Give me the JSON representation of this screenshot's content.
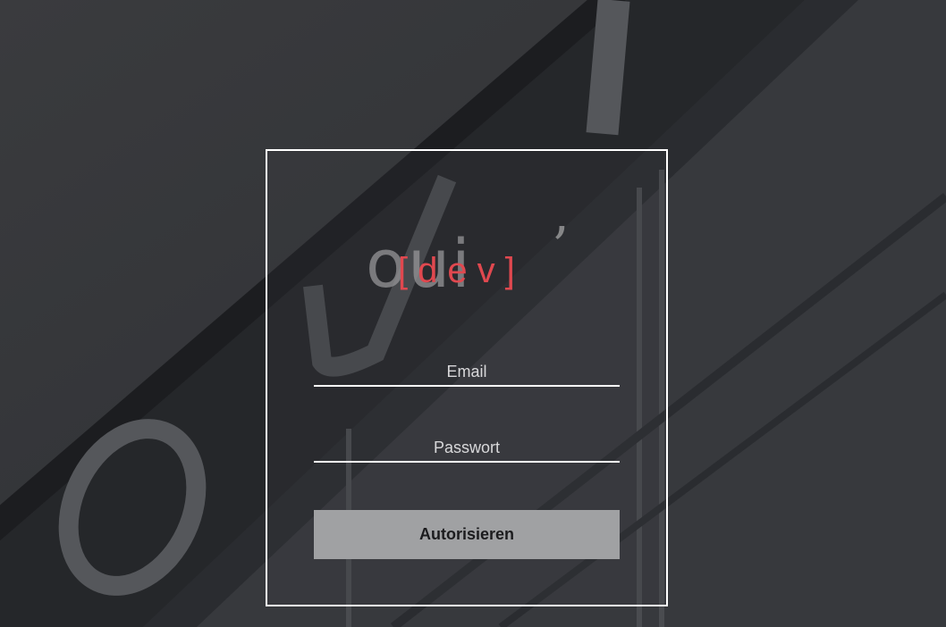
{
  "background": {
    "description_icon": "building-facade-photo",
    "overlay_color": "#333539"
  },
  "logo": {
    "word": "oui",
    "apostrophe": "’",
    "tag": "[dev]",
    "tag_color": "#e0484f"
  },
  "form": {
    "email_placeholder": "Email",
    "password_placeholder": "Passwort",
    "submit_label": "Autorisieren"
  },
  "colors": {
    "border": "#ffffff",
    "button_bg": "#a0a1a3",
    "button_text": "#1c1c1e"
  }
}
